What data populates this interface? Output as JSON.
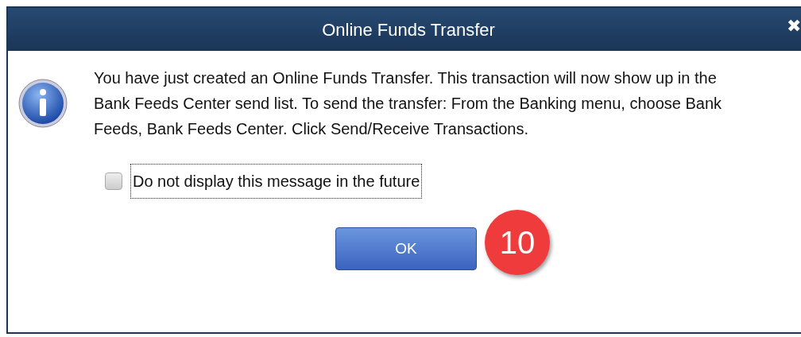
{
  "window": {
    "title": "Online Funds Transfer",
    "close_glyph": "✖"
  },
  "message": "You have just created an Online Funds Transfer. This transaction will now show up in the Bank Feeds Center send list. To send the transfer: From the Banking menu, choose Bank Feeds, Bank Feeds Center. Click Send/Receive Transactions.",
  "checkbox": {
    "label": "Do not display this message in the future",
    "checked": false
  },
  "buttons": [
    {
      "label": "OK"
    }
  ],
  "callout": {
    "text": "10"
  }
}
